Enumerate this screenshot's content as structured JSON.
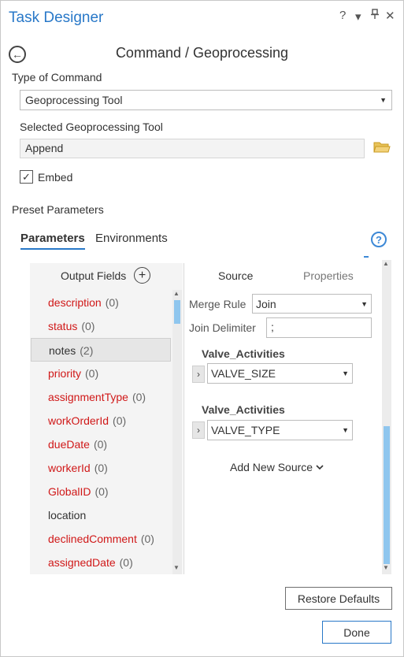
{
  "window": {
    "title": "Task Designer",
    "help_glyph": "?",
    "menu_glyph": "▾",
    "pin_glyph": "⊥",
    "close_glyph": "✕"
  },
  "header": {
    "back_glyph": "←",
    "title": "Command / Geoprocessing"
  },
  "command": {
    "type_label": "Type of Command",
    "type_value": "Geoprocessing Tool",
    "tool_label": "Selected Geoprocessing Tool",
    "tool_value": "Append",
    "embed_label": "Embed",
    "embed_checked": true,
    "check_glyph": "✓"
  },
  "preset": {
    "label": "Preset Parameters",
    "tabs": [
      "Parameters",
      "Environments"
    ],
    "help_glyph": "?"
  },
  "output_fields": {
    "header": "Output Fields",
    "add_glyph": "+",
    "items": [
      {
        "name": "description",
        "count": "(0)",
        "color": "red"
      },
      {
        "name": "status",
        "count": "(0)",
        "color": "red"
      },
      {
        "name": "notes",
        "count": "(2)",
        "color": "black"
      },
      {
        "name": "priority",
        "count": "(0)",
        "color": "red"
      },
      {
        "name": "assignmentType",
        "count": "(0)",
        "color": "red"
      },
      {
        "name": "workOrderId",
        "count": "(0)",
        "color": "red"
      },
      {
        "name": "dueDate",
        "count": "(0)",
        "color": "red"
      },
      {
        "name": "workerId",
        "count": "(0)",
        "color": "red"
      },
      {
        "name": "GlobalID",
        "count": "(0)",
        "color": "red"
      },
      {
        "name": "location",
        "count": "",
        "color": "black"
      },
      {
        "name": "declinedComment",
        "count": "(0)",
        "color": "red"
      },
      {
        "name": "assignedDate",
        "count": "(0)",
        "color": "red"
      }
    ],
    "selected_index": 2
  },
  "source": {
    "tabs": [
      "Source",
      "Properties"
    ],
    "merge_rule_label": "Merge Rule",
    "merge_rule_value": "Join",
    "join_delimiter_label": "Join Delimiter",
    "join_delimiter_value": ";",
    "sources": [
      {
        "table": "Valve_Activities",
        "field": "VALVE_SIZE"
      },
      {
        "table": "Valve_Activities",
        "field": "VALVE_TYPE"
      }
    ],
    "add_new_label": "Add New Source",
    "expand_glyph": "›",
    "chevron_glyph": "⌄"
  },
  "footer": {
    "restore_label": "Restore Defaults",
    "done_label": "Done"
  },
  "colors": {
    "accent": "#2878c8",
    "error_text": "#d01818",
    "scroll_thumb": "#8fc6ee",
    "folder": "#e6b93a"
  }
}
